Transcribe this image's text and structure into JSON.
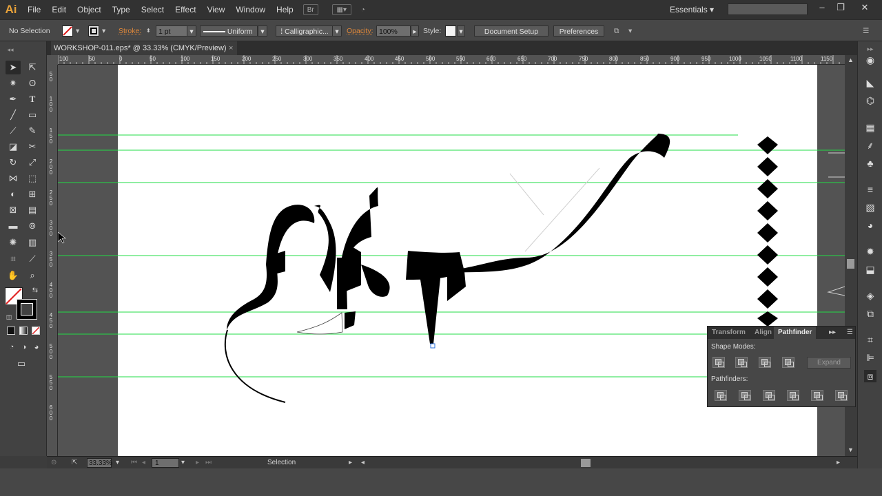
{
  "app": {
    "logo": "Ai",
    "menus": [
      "File",
      "Edit",
      "Object",
      "Type",
      "Select",
      "Effect",
      "View",
      "Window",
      "Help"
    ],
    "workspace": "Essentials",
    "search_placeholder": ""
  },
  "window_controls": {
    "minimize": "–",
    "restore": "❐",
    "close": "✕"
  },
  "control_bar": {
    "selection_state": "No Selection",
    "stroke_label": "Stroke:",
    "stroke_weight": "1 pt",
    "stroke_profile": "Uniform",
    "brush": "Calligraphic...",
    "opacity_label": "Opacity:",
    "opacity_value": "100%",
    "style_label": "Style:",
    "document_setup": "Document Setup",
    "preferences": "Preferences"
  },
  "document_tab": {
    "title": "WORKSHOP-011.eps* @ 33.33% (CMYK/Preview)",
    "close": "×"
  },
  "ruler_h_ticks": [
    "100",
    "50",
    "0",
    "50",
    "100",
    "150",
    "200",
    "250",
    "300",
    "350",
    "400",
    "450",
    "500",
    "550",
    "600",
    "650",
    "700",
    "750",
    "800",
    "850",
    "900",
    "950",
    "1000",
    "1050",
    "1100",
    "1150"
  ],
  "ruler_v_ticks": [
    [
      "5",
      "0"
    ],
    [
      "1",
      "0",
      "0"
    ],
    [
      "1",
      "5",
      "0"
    ],
    [
      "2",
      "0",
      "0"
    ],
    [
      "2",
      "5",
      "0"
    ],
    [
      "3",
      "0",
      "0"
    ],
    [
      "3",
      "5",
      "0"
    ],
    [
      "4",
      "0",
      "0"
    ],
    [
      "4",
      "5",
      "0"
    ],
    [
      "5",
      "0",
      "0"
    ],
    [
      "5",
      "5",
      "0"
    ],
    [
      "6",
      "0",
      "0"
    ]
  ],
  "status_bar": {
    "zoom": "33.33%",
    "artboard_number": "1",
    "tool_status": "Selection"
  },
  "pathfinder_panel": {
    "tabs": [
      "Transform",
      "Align",
      "Pathfinder"
    ],
    "active_tab": "Pathfinder",
    "shape_modes_label": "Shape Modes:",
    "expand_label": "Expand",
    "pathfinders_label": "Pathfinders:"
  },
  "colors": {
    "guide": "#22dd44",
    "artwork": "#000000",
    "ui_dark": "#323232",
    "accent_orange": "#e0883a"
  }
}
